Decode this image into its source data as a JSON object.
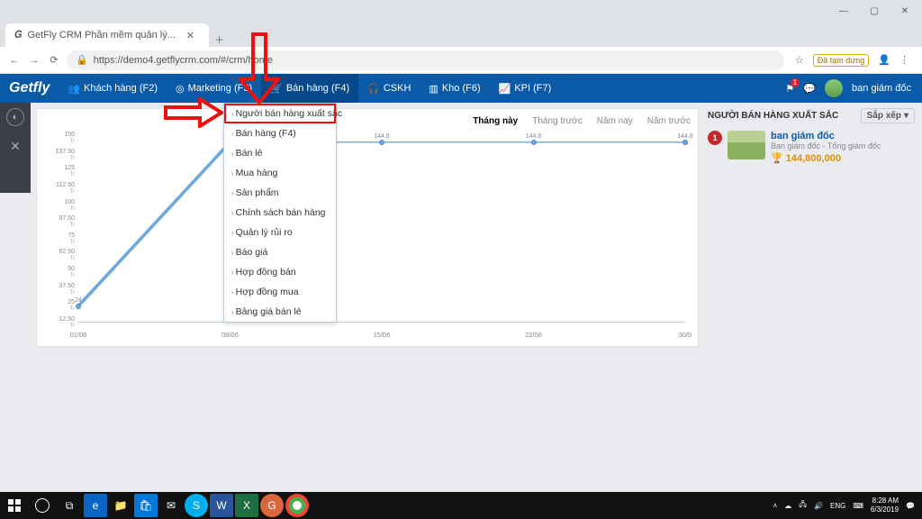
{
  "browser": {
    "tab_title": "GetFly CRM Phần mềm quản lý...",
    "url": "https://demo4.getflycrm.com/#/crm/home",
    "pause_label": "Đã tạm dừng"
  },
  "nav": {
    "logo": "Getfly",
    "items": [
      {
        "label": "Khách hàng (F2)"
      },
      {
        "label": "Marketing (F3)"
      },
      {
        "label": "Bán hàng (F4)"
      },
      {
        "label": "CSKH"
      },
      {
        "label": "Kho (F6)"
      },
      {
        "label": "KPI (F7)"
      }
    ],
    "user": "ban giám đốc"
  },
  "dropdown": {
    "items": [
      "Người bán hàng xuất sắc",
      "Bán hàng (F4)",
      "Bán lẻ",
      "Mua hàng",
      "Sản phẩm",
      "Chính sách bán hàng",
      "Quản lý rủi ro",
      "Báo giá",
      "Hợp đồng bán",
      "Hợp đồng mua",
      "Bảng giá bán lẻ"
    ]
  },
  "chart_header": {
    "this_month": "Tháng này",
    "last_month": "Tháng trước",
    "this_year": "Năm nay",
    "last_year": "Năm trước"
  },
  "chart_data": {
    "type": "line",
    "title": "",
    "xlabel": "",
    "ylabel": "",
    "y_ticks": [
      "150 Tr",
      "137.50 Tr",
      "125 Tr",
      "112.50 Tr",
      "100 Tr",
      "87.50 Tr",
      "75 Tr",
      "62.50 Tr",
      "50 Tr",
      "37.50 Tr",
      "25 Tr",
      "12.50 Tr"
    ],
    "x_ticks": [
      "01/06",
      "08/06",
      "15/06",
      "22/06",
      "30/0"
    ],
    "values": [
      24,
      144.8,
      144.8,
      144.8,
      144.8
    ],
    "point_labels": [
      "24",
      "144.8",
      "144.8",
      "144.8",
      "144.8"
    ],
    "ylim": [
      12.5,
      150
    ],
    "unit": "Tr"
  },
  "right": {
    "title": "NGƯỜI BÁN HÀNG XUẤT SẮC",
    "sort": "Sắp xếp",
    "seller": {
      "rank": "1",
      "name": "ban giám đốc",
      "subtitle": "Ban giám đốc - Tổng giám đốc",
      "value": "144,800,000"
    }
  },
  "taskbar": {
    "lang": "ENG",
    "time": "8:28 AM",
    "date": "6/3/2019"
  }
}
